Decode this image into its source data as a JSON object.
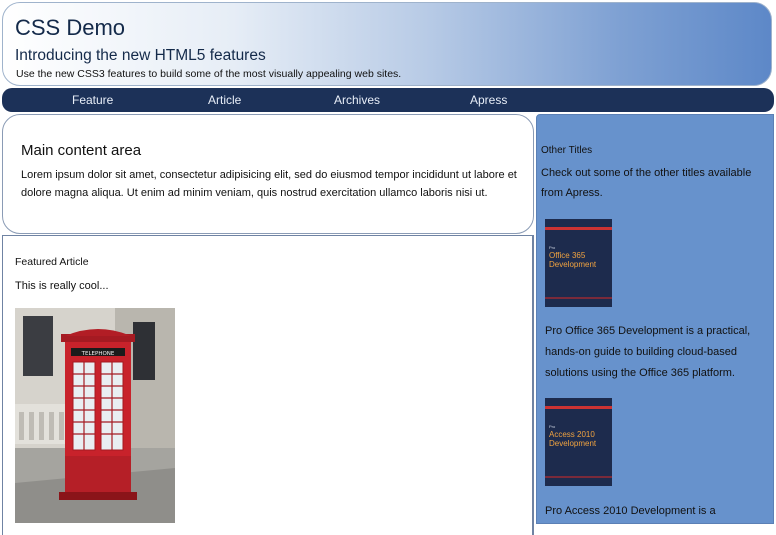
{
  "header": {
    "title": "CSS Demo",
    "subtitle": "Introducing the new HTML5 features",
    "tagline": "Use the new CSS3 features to build some of the most visually appealing web sites."
  },
  "nav": {
    "items": [
      {
        "label": "Feature"
      },
      {
        "label": "Article"
      },
      {
        "label": "Archives"
      },
      {
        "label": "Apress"
      }
    ]
  },
  "main": {
    "title": "Main content area",
    "text": "Lorem ipsum dolor sit amet, consectetur adipisicing elit, sed do eiusmod tempor incididunt ut labore et dolore magna aliqua. Ut enim ad minim veniam, quis nostrud exercitation ullamco laboris nisi ut."
  },
  "article": {
    "title": "Featured Article",
    "text": "This is really cool...",
    "image_icon": "red-phone-box-photo"
  },
  "sidebar": {
    "title": "Other Titles",
    "intro": "Check out some of the other titles available from Apress.",
    "books": [
      {
        "cover_small": "Pro",
        "cover_title_line1": "Office 365",
        "cover_title_line2": "Development",
        "description": "Pro Office 365 Development is a practical, hands-on guide to building cloud-based solutions using the Office 365 platform."
      },
      {
        "cover_small": "Pro",
        "cover_title_line1": "Access 2010",
        "cover_title_line2": "Development",
        "description": "Pro Access 2010 Development is a"
      }
    ]
  },
  "colors": {
    "nav_bg": "#1c3158",
    "sidebar_bg": "#6792cc",
    "title_color": "#142a4a"
  }
}
